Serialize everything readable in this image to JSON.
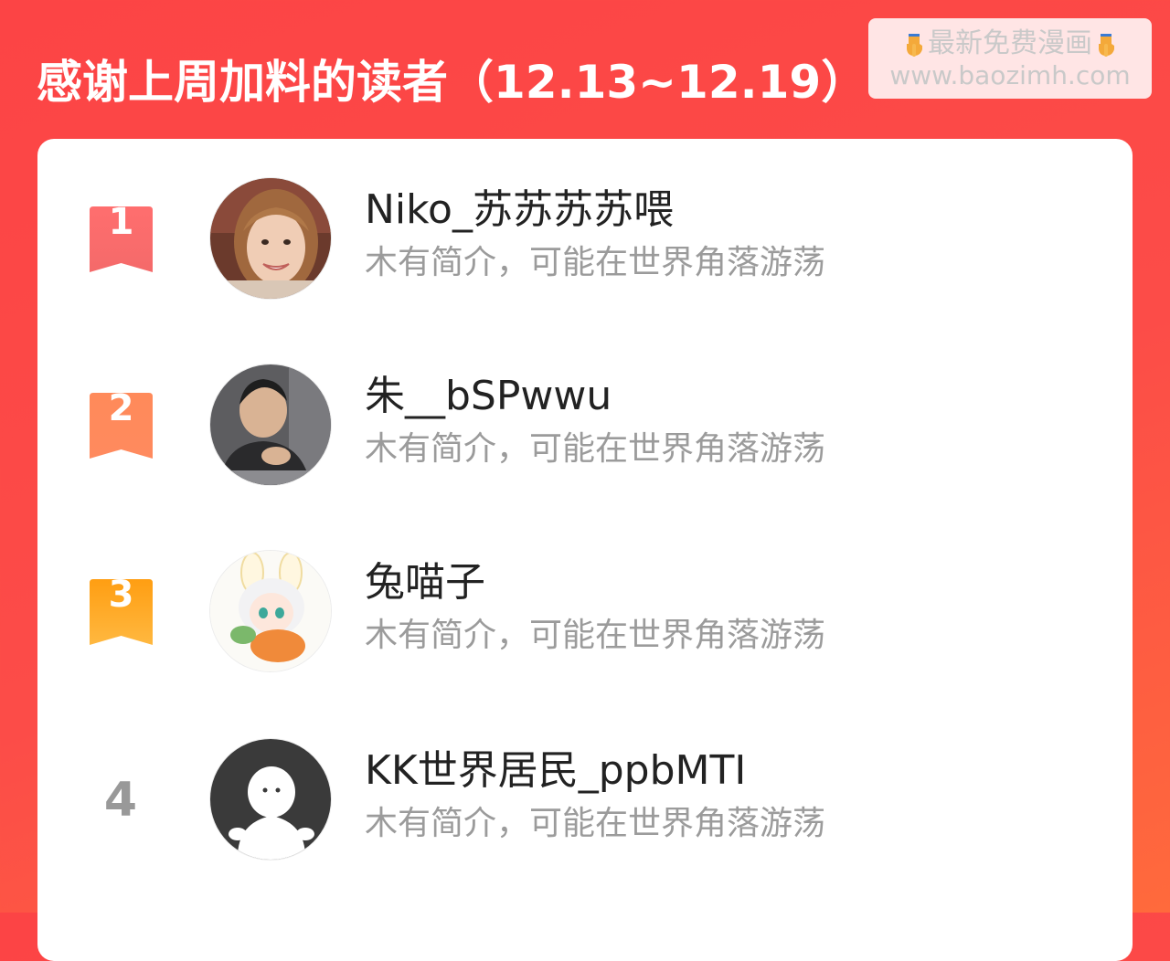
{
  "header": {
    "title": "感谢上周加料的读者（12.13~12.19）"
  },
  "watermark": {
    "line1": "最新免费漫画",
    "line2": "www.baozimh.com",
    "icon": "pointing-down-hand-icon"
  },
  "colors": {
    "background": "#fc4445",
    "background_end": "#ff6a3c",
    "rank1": "#fa5a5a",
    "rank2": "#ff8155",
    "rank3": "#ffa51e",
    "rank_plain": "#999999"
  },
  "readers": [
    {
      "rank": "1",
      "name": "Niko_苏苏苏苏喂",
      "bio": "木有简介，可能在世界角落游荡",
      "avatar": "woman-photo-avatar"
    },
    {
      "rank": "2",
      "name": "朱__bSPwwu",
      "bio": "木有简介，可能在世界角落游荡",
      "avatar": "man-photo-avatar"
    },
    {
      "rank": "3",
      "name": "兔喵子",
      "bio": "木有简介，可能在世界角落游荡",
      "avatar": "anime-bunny-girl-avatar"
    },
    {
      "rank": "4",
      "name": "KK世界居民_ppbMTI",
      "bio": "木有简介，可能在世界角落游荡",
      "avatar": "default-ghost-avatar"
    }
  ]
}
